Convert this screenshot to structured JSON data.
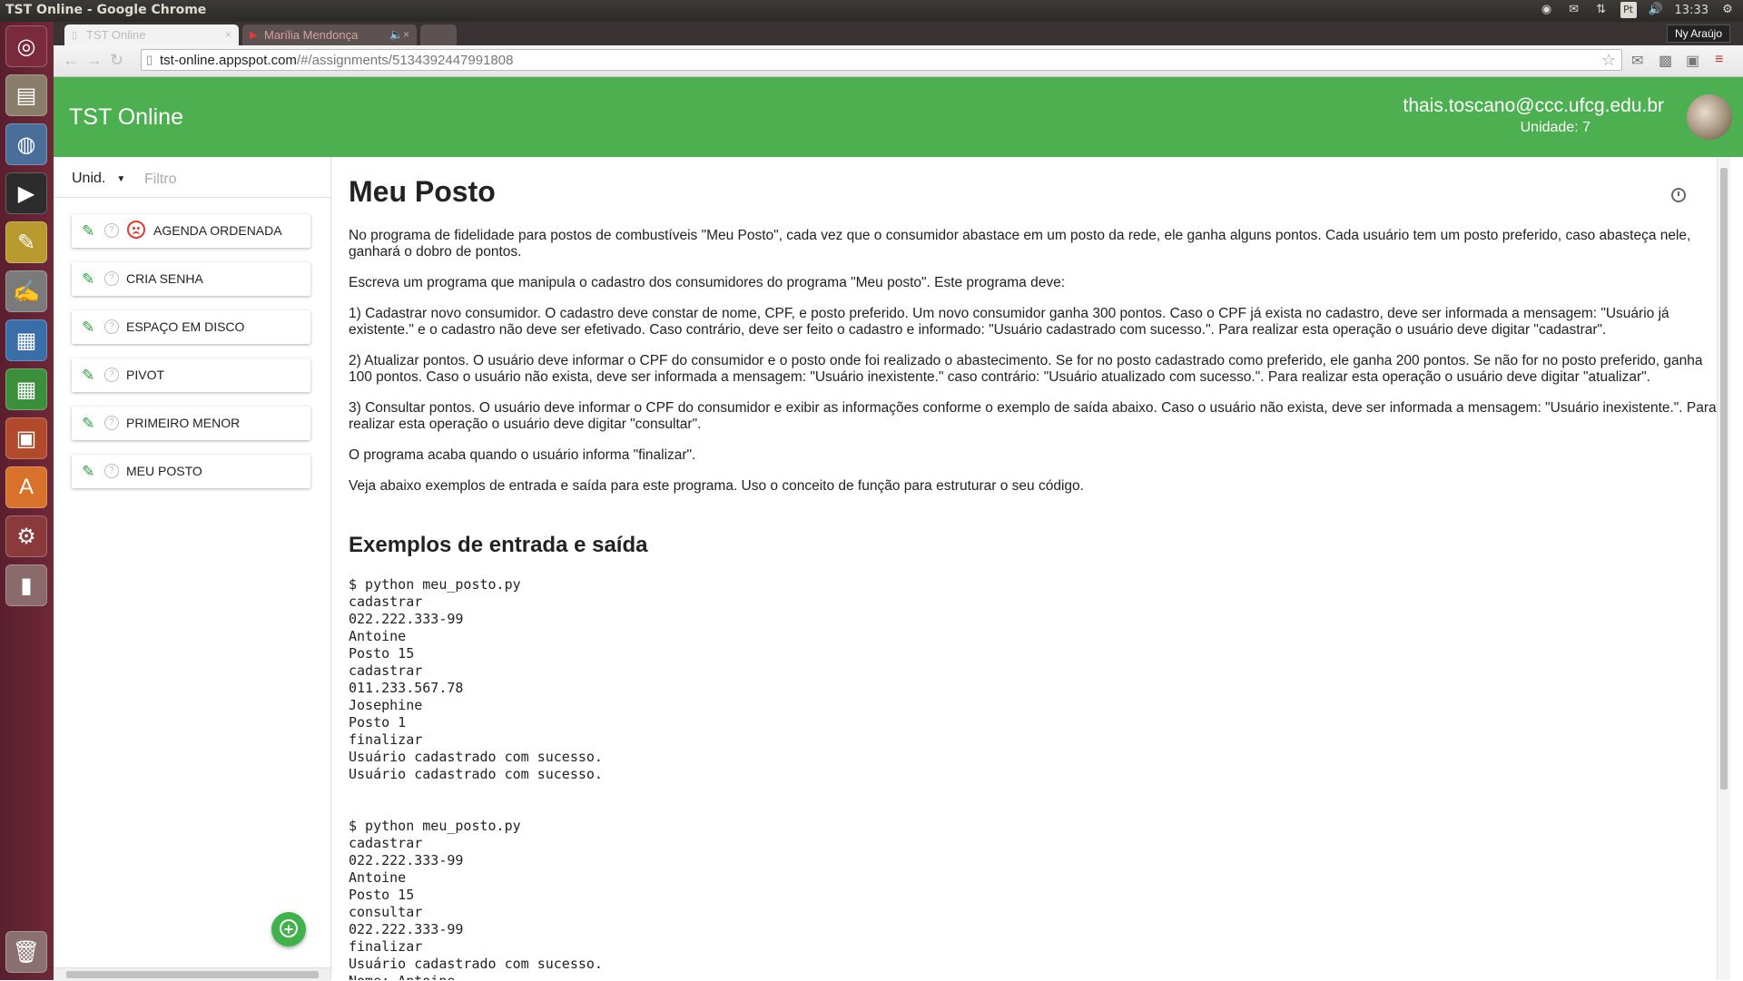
{
  "os": {
    "window_title": "TST Online - Google Chrome",
    "clock": "13:33",
    "keyboard_layout": "Pt",
    "launcher_icons": [
      "ubuntu-dash-icon",
      "files-icon",
      "chrome-icon",
      "terminal-icon",
      "gimp-icon",
      "text-editor-icon",
      "writer-icon",
      "calc-icon",
      "impress-icon",
      "software-center-icon",
      "settings-icon",
      "usb-drive-icon",
      "trash-icon"
    ]
  },
  "browser": {
    "tabs": [
      {
        "label": "TST Online",
        "active": true
      },
      {
        "label": "Marília Mendonça",
        "active": false
      }
    ],
    "user": "Ny Araújo",
    "url_host": "tst-online.appspot.com",
    "url_path": "/#/assignments/5134392447991808"
  },
  "app": {
    "brand": "TST Online",
    "user_email": "thais.toscano@ccc.ufcg.edu.br",
    "unit_label": "Unidade: 7",
    "accent_color": "#4caf50"
  },
  "sidebar": {
    "unit_select": "Unid.",
    "filter_placeholder": "Filtro",
    "assignments": [
      {
        "label": "AGENDA ORDENADA",
        "failed": true
      },
      {
        "label": "CRIA SENHA",
        "failed": false
      },
      {
        "label": "ESPAÇO EM DISCO",
        "failed": false
      },
      {
        "label": "PIVOT",
        "failed": false
      },
      {
        "label": "PRIMEIRO MENOR",
        "failed": false
      },
      {
        "label": "MEU POSTO",
        "failed": false
      }
    ]
  },
  "assignment": {
    "title": "Meu Posto",
    "paragraphs": [
      "No programa de fidelidade para postos de combustíveis \"Meu Posto\", cada vez que o consumidor abastace em um posto da rede, ele ganha alguns pontos. Cada usuário tem um posto preferido, caso abasteça nele, ganhará o dobro de pontos.",
      "Escreva um programa que manipula o cadastro dos consumidores do programa \"Meu posto\". Este programa deve:",
      "1) Cadastrar novo consumidor. O cadastro deve constar de nome, CPF, e posto preferido. Um novo consumidor ganha 300 pontos. Caso o CPF já exista no cadastro, deve ser informada a mensagem: \"Usuário já existente.\" e o cadastro não deve ser efetivado. Caso contrário, deve ser feito o cadastro e informado: \"Usuário cadastrado com sucesso.\". Para realizar esta operação o usuário deve digitar \"cadastrar\".",
      "2) Atualizar pontos. O usuário deve informar o CPF do consumidor e o posto onde foi realizado o abastecimento. Se for no posto cadastrado como preferido, ele ganha 200 pontos. Se não for no posto preferido, ganha 100 pontos. Caso o usuário não exista, deve ser informada a mensagem: \"Usuário inexistente.\" caso contrário: \"Usuário atualizado com sucesso.\". Para realizar esta operação o usuário deve digitar \"atualizar\".",
      "3) Consultar pontos. O usuário deve informar o CPF do consumidor e exibir as informações conforme o exemplo de saída abaixo. Caso o usuário não exista, deve ser informada a mensagem: \"Usuário inexistente.\". Para realizar esta operação o usuário deve digitar \"consultar\".",
      "O programa acaba quando o usuário informa \"finalizar\".",
      "Veja abaixo exemplos de entrada e saída para este programa. Uso o conceito de função para estruturar o seu código."
    ],
    "examples_heading": "Exemplos de entrada e saída",
    "example1": "$ python meu_posto.py\ncadastrar\n022.222.333-99\nAntoine\nPosto 15\ncadastrar\n011.233.567.78\nJosephine\nPosto 1\nfinalizar\nUsuário cadastrado com sucesso.\nUsuário cadastrado com sucesso.",
    "example2": "$ python meu_posto.py\ncadastrar\n022.222.333-99\nAntoine\nPosto 15\nconsultar\n022.222.333-99\nfinalizar\nUsuário cadastrado com sucesso.\nNome: Antoine"
  }
}
